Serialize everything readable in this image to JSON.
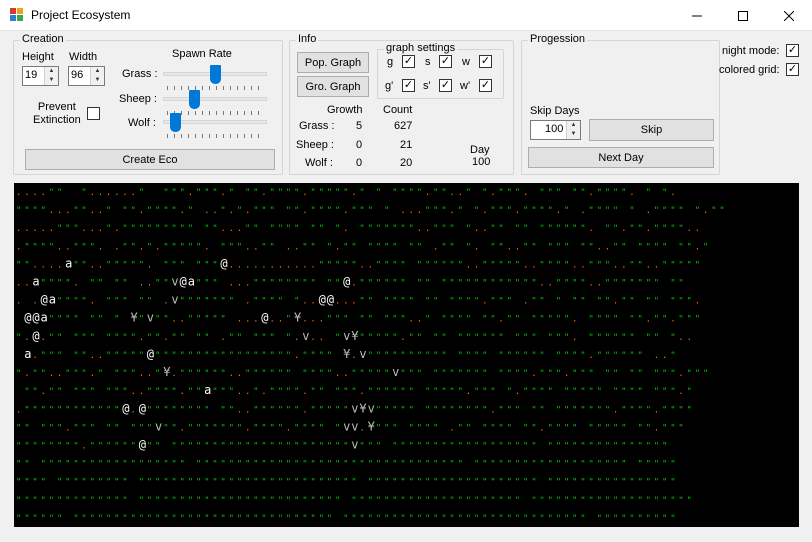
{
  "window": {
    "title": "Project Ecosystem",
    "icon": "app-window-icon"
  },
  "creation": {
    "group_label": "Creation",
    "height_label": "Height",
    "height_value": "19",
    "width_label": "Width",
    "width_value": "96",
    "spawn_rate_label": "Spawn Rate",
    "grass_label": "Grass :",
    "sheep_label": "Sheep :",
    "wolf_label": "Wolf :",
    "spawn_rates": {
      "grass": 0.5,
      "sheep": 0.28,
      "wolf": 0.08
    },
    "prevent_extinction_label": "Prevent\nExtinction",
    "prevent_extinction_checked": false,
    "create_button": "Create Eco"
  },
  "info": {
    "group_label": "Info",
    "pop_graph_button": "Pop. Graph",
    "gro_graph_button": "Gro. Graph",
    "graph_settings_label": "graph settings",
    "graph_options": [
      {
        "label": "g",
        "checked": true
      },
      {
        "label": "s",
        "checked": true
      },
      {
        "label": "w",
        "checked": true
      },
      {
        "label": "g'",
        "checked": true
      },
      {
        "label": "s'",
        "checked": true
      },
      {
        "label": "w'",
        "checked": true
      }
    ],
    "growth_header": "Growth",
    "count_header": "Count",
    "rows": [
      {
        "label": "Grass :",
        "growth": "5",
        "count": "627"
      },
      {
        "label": "Sheep :",
        "growth": "0",
        "count": "21"
      },
      {
        "label": "Wolf :",
        "growth": "0",
        "count": "20"
      }
    ],
    "day_label": "Day",
    "day_value": "100"
  },
  "progression": {
    "group_label": "Progession",
    "skip_days_label": "Skip Days",
    "skip_days_value": "100",
    "skip_button": "Skip",
    "next_day_button": "Next Day"
  },
  "options": {
    "night_mode_label": "night mode:",
    "night_mode_checked": true,
    "colored_grid_label": "colored grid:",
    "colored_grid_checked": true
  },
  "grid": {
    "colors": {
      "grass": "#00c800",
      "empty": "#ff7800",
      "sheep": "#bdbdbd",
      "wolf": "#ffffff",
      "background": "#000000"
    },
    "glyphs": {
      "grass": "\"",
      "empty": ".",
      "sheep": "v",
      "wolf": "@",
      "sheep_pair": "¥",
      "wolf_pair": "a"
    },
    "rows": [
      "....\"\"  \"......\"  \"\"\".\"\"\".\" \"\".\"\"\"\".\"\"\"\"\".\" \" \"\"\"\".\"\"..\" \".\"\"\". \"\"\" \"\".\"\"\"\". \" \".",
      "\"\"\"\"...\"\"..\" \"\".\"\"\"\".\" ..\".\".\"\"\" \"\".\"\"\"\".\"\"\" \" ...\"\"\".\" \".\"\"\".\"\"\"\".\" .\"\"\"\" \" .\"\"\"\" \".\"\"",
      ".....\"\"\"...\".\"\"\"\"\"\"\"\"\" \"\"...\"\" \"\"\"\" \"\" \". \"\"\"\"\"\"\"..\"\"\" \"..\"\" \"\" \"\"\"\"\"\". \"\".\"\".\"\"\"\"..",
      ".\"\"\"\"..\"\"\". .\"\".\".\"\"\"\"\". \"\"\"..\"\" ..\"\" \".\"\" \"\"\"\" \"\" .\"\" \". \"\"..\"\" \"\"\" \"\"..\"\" \"\"\"\" \"\".\"",
      "\"\"....a\"\"..\"\"\"\"\". \"\"\" \"\"\"@...........\"\"\"\"\"..\"\"\"\" \"\"\"\"\"\"..\"\"\"\"\"..\"\"\"\"..\"\"\"..\"\"..\"\"\"\"\"",
      "..a\"\"\"\". \"\" \"\" ..\"\"v@a\"\"\" ...\"\"\"\"\"\"\"\" \"\"@.\"\"\"\"\"\" \"\" \"\"\"\"\"\"\"\"\"\"\"\"..\"\"\"\"..\"\"\"\"\"\"\" \"\"",
      ". .@a\"\"\"\". \"\"\" \"\" .v\"\"\"\"\"\"\" .\"\"\"\" \"..@@...\"\" \"\"\"\" \"\" \"\"\"\".\"\"\" .\"\" \" \"\" \"\".\"\" \"\" \"\"\".",
      " @@a\"\"\"\" \"\" \" ¥\"v\"\"..\"\"\"\"\" ...@..\"¥...\"\"\" \"\" \"\"\"..\" \"\"\"\" \"\".\"\" \"\"\"\"\". \"\"\"\" \"\".\"\".\"\"\"",
      "\".@.\"\" \"\"\" \"\"\"\".\"\".\"\" \"\" .\"\" \"\"\" \".v.. \"v¥\"\"\"\"\".\"\" \"\" \"\"\"\"\"\" \"\"\" \"\"\". \"\"\"\"\"\" \"\" \"..",
      " a.\"\"\" \"\"..\"\"\"\"\"@\"\"\"\"\"\"\"\"\"\"\"\"\"\"\"\"\".\"\"\"\" ¥.v\"\"\"\"\"\"\"\"\"\" \"\"\"\" \"\"\"\"\"\" \"\"\"\".\"\"\"\"\"\" ..\"",
      "\".\"\"..\"\"\".\" \"\"\"..\"¥.\"\"\"\"\"\"..\"\"\"\"\"\" \"\"\"\"..\"\"\"\"\"v\"\"\" \"\"\"\"\"\"\" \"\"\"\".\"\"\".\"\"\" \"\" \"\" \"\"\".\"\"\"",
      " \"\".\"\" \"\"\" \"\"\"..\"\"\"\".\"\"a\"\"\"..\".\"\"\"\".\"\" \"\"\".\"\"\"\"\"\" \"\"\"\"\".\"\"\" \".\"\"\"\" \"\"\"\"\" \"\"\"\" \"\"\".\"",
      ".\"\"\"\"\"\"\"\"\"\"\"\"@.@\"\"\"\"\"\"\"\" \"\"..\"\"\"\"\"\".\"\"\"\"\"v¥v\"\"\"\"\" \"\"\"\"\"\"\"\".\"\"\" \"\" \"\"\"\"\"\"\".\"\"\"\".\"\"\"\"",
      "\"\" \"\"\".\"\"\" \"\" \"\"\"v\"\".\"\"\"\"\"\"\".\"\"\"\".\"\"\"\" \"vv.¥\"\"\" \"\"\"\" .\"\" \"\"\"\" \"\".\"\"\"\" \"\"\"\"\" \"\".\"\"\"",
      "\"\"\"\"\"\"\"\".\"\"\"\"\"\"@\"\" \"\"\"\"\"\"\"\"\"\"\"\"\"\"\"\"\"\"\"\"\"\"v\"\"\" \"\"\"\"\"\"\"\"\"\"\"\"\"\"\"\"\"\" \"\"\"\"\"\"\"\"\"\"\"\"\"\"\"",
      "\"\" \"\"\"\"\"\"\"\"\"\"\"\"\"\"\"\"\"\" \"\"\"\"\"\"\"\"\"\"\"\"\"\"\"\"\"\"\"\"\"\"\"\"\"\"\"\"\"\"\"\"\" \"\"\"\"\"\"\"\"\"\"\"\"\"\"\"\"\"\"\" \"\"\"\"\"",
      "\"\"\"\" \"\"\"\"\"\"\"\"\" \"\"\"\"\"\"\"\"\"\"\"\"\"\"\"\"\"\"\"\"\"\"\"\"\"\"\" \"\"\"\"\"\"\"\"\"\"\"\"\"\"\"\"\"\"\"\"\" \"\"\"\"\"\"\"\"\"\"\"\"\"\"\"\"",
      "\"\"\"\"\"\"\"\"\"\"\"\"\"\" \"\"\"\"\"\"\"\"\"\"\"\"\"\"\"\"\"\"\"\"\"\"\"\"\" \"\"\"\"\"\"\"\"\"\"\"\"\"\"\"\"\"\"\"\"\" \"\"\"\"\"\"\"\"\"\"\"\"\"\"\"\"\"\"\"\"",
      "\"\"\"\"\"\" \"\"\"\"\"\"\"\"\"\"\"\"\"\"\"\"\"\"\"\"\"\"\"\"\"\"\"\"\"\"\"\" \"\"\"\"\"\"\"\"\"\"\"\"\"\"\"\"\"\"\"\"\"\"\"\"\"\"\"\"\"\" \"\"\"\"\"\"\"\"\"\""
    ]
  }
}
